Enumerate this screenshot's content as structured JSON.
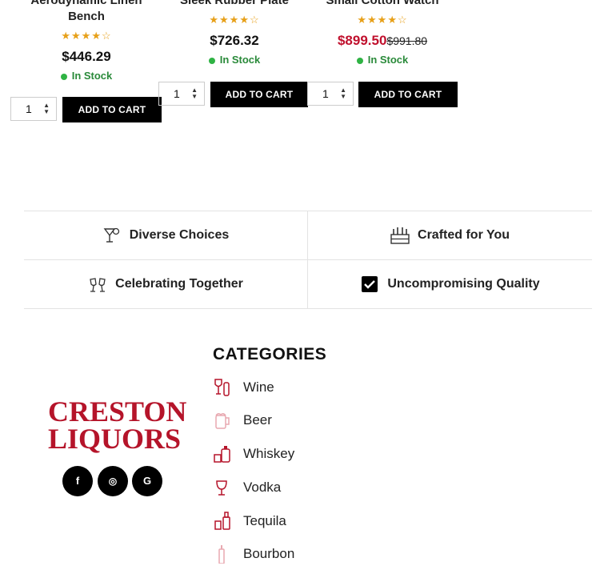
{
  "products": [
    {
      "title_line1": "Aerodynamic Linen",
      "title_line2": "Bench",
      "rating": "★★★★☆",
      "price": "$446.29",
      "old_price": "",
      "stock": "In Stock",
      "qty": "1",
      "cart_label": "ADD TO CART"
    },
    {
      "title_line1": "Sleek Rubber Plate",
      "title_line2": "",
      "rating": "★★★★☆",
      "price": "$726.32",
      "old_price": "",
      "stock": "In Stock",
      "qty": "1",
      "cart_label": "ADD TO CART"
    },
    {
      "title_line1": "Small Cotton Watch",
      "title_line2": "",
      "rating": "★★★★☆",
      "price": "$899.50",
      "old_price": "$991.80",
      "stock": "In Stock",
      "qty": "1",
      "cart_label": "ADD TO CART"
    }
  ],
  "features": [
    {
      "label": "Diverse Choices",
      "icon": "cocktail-icon"
    },
    {
      "label": "Crafted for You",
      "icon": "crate-icon"
    },
    {
      "label": "Celebrating Together",
      "icon": "cheers-icon"
    },
    {
      "label": "Uncompromising Quality",
      "icon": "checkbox-icon"
    }
  ],
  "brand": {
    "line1": "CRESTON",
    "line2": "LIQUORS",
    "color": "#b5142a"
  },
  "social": [
    {
      "glyph": "f",
      "icon": "facebook-icon"
    },
    {
      "glyph": "◎",
      "icon": "instagram-icon"
    },
    {
      "glyph": "G",
      "icon": "google-icon"
    }
  ],
  "categories": {
    "title": "CATEGORIES",
    "items": [
      {
        "label": "Wine",
        "icon": "wine-icon"
      },
      {
        "label": "Beer",
        "icon": "beer-icon"
      },
      {
        "label": "Whiskey",
        "icon": "whiskey-icon"
      },
      {
        "label": "Vodka",
        "icon": "vodka-icon"
      },
      {
        "label": "Tequila",
        "icon": "tequila-icon"
      },
      {
        "label": "Bourbon",
        "icon": "bourbon-icon"
      }
    ]
  },
  "colors": {
    "accent": "#c0102d",
    "stock_green": "#2fb344",
    "star": "#e7a019"
  }
}
